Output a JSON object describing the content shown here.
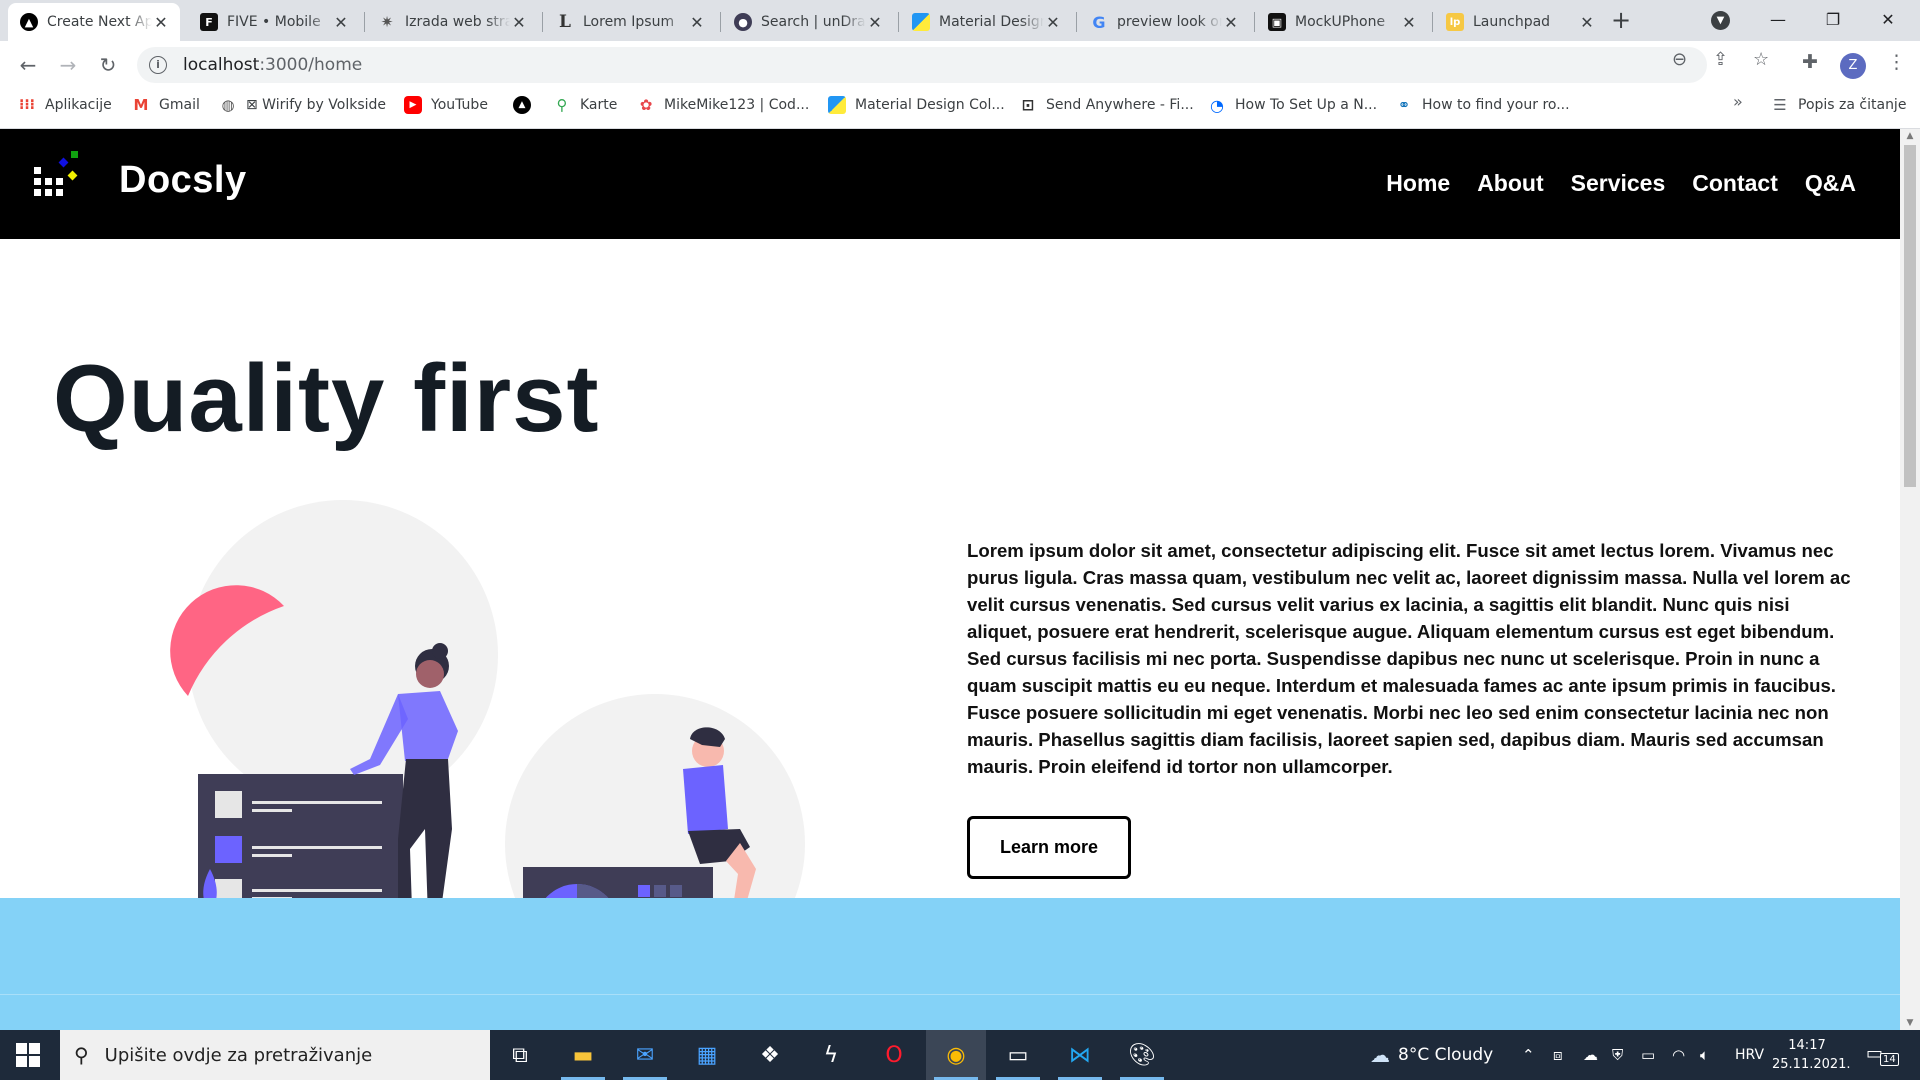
{
  "browser": {
    "tabs": [
      {
        "title": "Create Next App",
        "favicon": "nextjs-triangle-icon",
        "active": true
      },
      {
        "title": "FIVE • Mobile",
        "favicon": "five-f-icon"
      },
      {
        "title": "Izrada web stranica",
        "favicon": "gear-sparkle-icon"
      },
      {
        "title": "Lorem Ipsum",
        "favicon": "lorem-l-icon"
      },
      {
        "title": "Search | unDraw",
        "favicon": "undraw-icon"
      },
      {
        "title": "Material Design",
        "favicon": "material-colors-icon"
      },
      {
        "title": "preview look on",
        "favicon": "google-g-icon"
      },
      {
        "title": "MockUPhone",
        "favicon": "mockuphone-icon"
      },
      {
        "title": "Launchpad",
        "favicon": "launchpad-lp-icon"
      }
    ],
    "address": {
      "host": "localhost",
      "path": ":3000/home"
    },
    "profile_initial": "Z",
    "bookmarks": [
      {
        "label": "Aplikacije",
        "icon": "apps-grid-icon"
      },
      {
        "label": "Gmail",
        "icon": "gmail-icon"
      },
      {
        "label": "⊠ Wirify by Volkside",
        "icon": "globe-icon"
      },
      {
        "label": "YouTube",
        "icon": "youtube-icon"
      },
      {
        "label": "",
        "icon": "nextjs-triangle-icon"
      },
      {
        "label": "Karte",
        "icon": "maps-pin-icon"
      },
      {
        "label": "MikeMike123 | Cod...",
        "icon": "openai-knot-icon"
      },
      {
        "label": "Material Design Col...",
        "icon": "material-colors-icon"
      },
      {
        "label": "Send Anywhere - Fi...",
        "icon": "send-anywhere-icon"
      },
      {
        "label": "How To Set Up a N...",
        "icon": "digitalocean-icon"
      },
      {
        "label": "How to find your ro...",
        "icon": "router-icon"
      }
    ],
    "bookmarks_overflow": "»",
    "reading_list": "Popis za čitanje"
  },
  "site": {
    "brand": "Docsly",
    "nav": [
      "Home",
      "About",
      "Services",
      "Contact",
      "Q&A"
    ],
    "hero": {
      "title": "Quality first",
      "body": "Lorem ipsum dolor sit amet, consectetur adipiscing elit. Fusce sit amet lectus lorem. Vivamus nec purus ligula. Cras massa quam, vestibulum nec velit ac, laoreet dignissim massa. Nulla vel lorem ac velit cursus venenatis. Sed cursus velit varius ex lacinia, a sagittis elit blandit. Nunc quis nisi aliquet, posuere erat hendrerit, scelerisque augue. Aliquam elementum cursus est eget bibendum. Sed cursus facilisis mi nec porta. Suspendisse dapibus nec nunc ut scelerisque. Proin in nunc a quam suscipit mattis eu eu neque. Interdum et malesuada fames ac ante ipsum primis in faucibus. Fusce posuere sollicitudin mi eget venenatis. Morbi nec leo sed enim consectetur lacinia nec non mauris. Phasellus sagittis diam facilisis, laoreet sapien sed, dapibus diam. Mauris sed accumsan mauris. Proin eleifend id tortor non ullamcorper.",
      "button": "Learn more"
    },
    "colors": {
      "nav_bg": "#000000",
      "band": "#84d2f7",
      "accent_purple": "#6c63ff",
      "accent_pink": "#ff6584"
    }
  },
  "taskbar": {
    "search_placeholder": "Upišite ovdje za pretraživanje",
    "weather": "8°C  Cloudy",
    "language": "HRV",
    "time": "14:17",
    "date": "25.11.2021.",
    "notifications": "14"
  }
}
